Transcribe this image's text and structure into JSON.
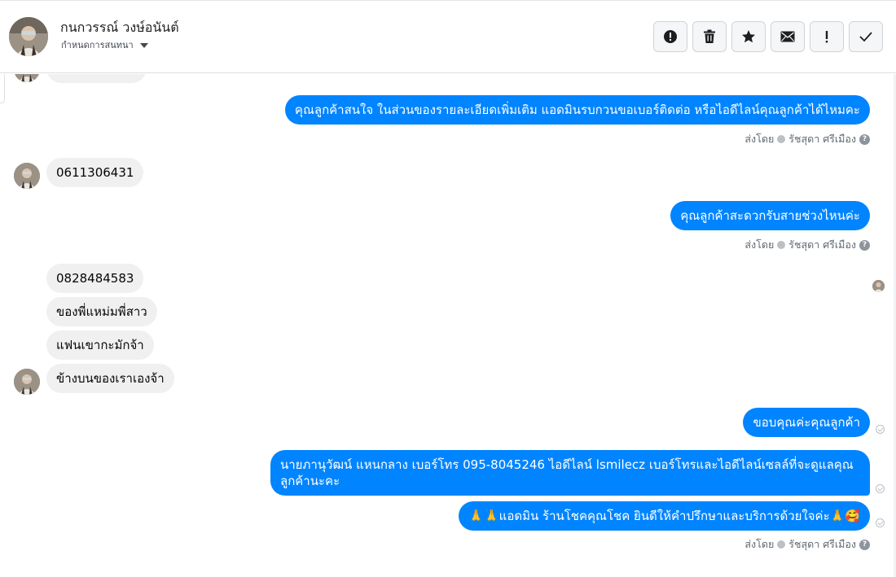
{
  "header": {
    "contact_name": "กนกวรรณ์ วงษ์อนันต์",
    "assign_label": "กำหนดการสนทนา",
    "actions": [
      {
        "name": "spam-report-button",
        "icon": "alert-circle-icon"
      },
      {
        "name": "delete-button",
        "icon": "trash-icon"
      },
      {
        "name": "star-button",
        "icon": "star-icon"
      },
      {
        "name": "mark-unread-button",
        "icon": "envelope-icon"
      },
      {
        "name": "follow-up-button",
        "icon": "exclamation-icon"
      },
      {
        "name": "mark-done-button",
        "icon": "check-icon"
      }
    ]
  },
  "messages": {
    "out_1": "คุณลูกค้าสนใจ ในส่วนของรายละเอียดเพิ่มเติม แอดมินรบกวนขอเบอร์ติดต่อ หรือไอดีไลน์คุณลูกค้าได้ไหมคะ",
    "in_1": "0611306431",
    "out_2": "คุณลูกค้าสะดวกรับสายช่วงไหนค่ะ",
    "in_2": "0828484583",
    "in_3": "ของพี่แหม่มพี่สาว",
    "in_4": "แฟนเขากะมักจ้า",
    "in_5": "ข้างบนของเราเองจ้า",
    "out_3": "ขอบคุณค่ะคุณลูกค้า",
    "out_4": "นายภานุวัฒน์ แหนกลาง เบอร์โทร 095-8045246 ไอดีไลน์ lsmilecz  เบอร์โทรและไอดีไลน์เซลล์ที่จะดูแลคุณลูกค้านะคะ",
    "out_5": "🙏🙏แอดมิน ร้านโชคคุณโชค ยินดีให้คำปรึกษาและบริการด้วยใจค่ะ🙏🥰"
  },
  "sent_by": {
    "prefix": "ส่งโดย",
    "agent": "รัชสุดา ศรีเมือง"
  }
}
